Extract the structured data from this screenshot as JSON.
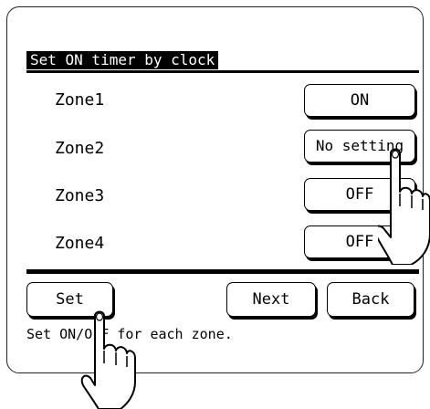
{
  "screen": {
    "title": "Set ON timer by clock",
    "zones": [
      {
        "label": "Zone1",
        "value": "ON"
      },
      {
        "label": "Zone2",
        "value": "No setting"
      },
      {
        "label": "Zone3",
        "value": "OFF"
      },
      {
        "label": "Zone4",
        "value": "OFF"
      }
    ],
    "buttons": {
      "set": "Set",
      "next": "Next",
      "back": "Back"
    },
    "hint": "Set ON/OFF for each zone."
  },
  "icons": [
    "pointing-hand-icon"
  ]
}
